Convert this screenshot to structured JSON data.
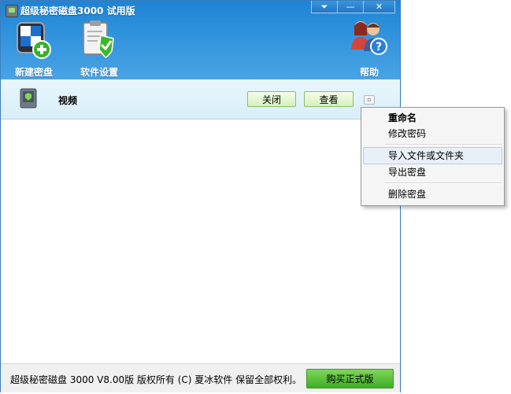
{
  "window": {
    "title": "超级秘密磁盘3000 试用版",
    "controls": {
      "menu": "⏷",
      "minimize": "—",
      "close": "✕"
    }
  },
  "toolbar": {
    "new_disk": "新建密盘",
    "settings": "软件设置",
    "help": "帮助"
  },
  "disk": {
    "name": "视频",
    "close_label": "关闭",
    "view_label": "查看",
    "more_label": "▫"
  },
  "context_menu": {
    "rename": "重命名",
    "change_password": "修改密码",
    "import": "导入文件或文件夹",
    "export": "导出密盘",
    "delete": "删除密盘"
  },
  "footer": {
    "copyright": "超级秘密磁盘 3000 V8.00版  版权所有 (C) 夏冰软件 保留全部权利。",
    "buy_label": "购买正式版"
  },
  "colors": {
    "titlebar": "#2f92dd",
    "button_green": "#d6f0bd",
    "buy_green": "#3fae24"
  }
}
